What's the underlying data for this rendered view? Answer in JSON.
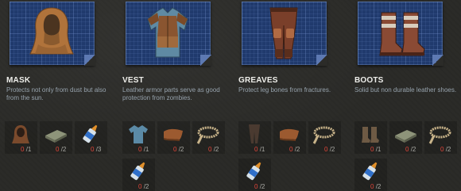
{
  "items": [
    {
      "title": "MASK",
      "description": "Protects not only from dust but also from the sun.",
      "item_icon": "hooded-mask-icon",
      "materials": [
        {
          "icon": "face-cloth-icon",
          "have": "0",
          "need": "/1"
        },
        {
          "icon": "fabric-stack-icon",
          "have": "0",
          "need": "/2"
        },
        {
          "icon": "glue-bottle-icon",
          "have": "0",
          "need": "/3"
        }
      ]
    },
    {
      "title": "VEST",
      "description": "Leather armor parts serve as good protection from zombies.",
      "item_icon": "armored-vest-icon",
      "materials": [
        {
          "icon": "shirt-icon",
          "have": "0",
          "need": "/1"
        },
        {
          "icon": "leather-icon",
          "have": "0",
          "need": "/2"
        },
        {
          "icon": "rope-icon",
          "have": "0",
          "need": "/2"
        },
        {
          "icon": "glue-bottle-icon",
          "have": "0",
          "need": "/2"
        }
      ]
    },
    {
      "title": "GREAVES",
      "description": "Protect leg bones from fractures.",
      "item_icon": "greaves-icon",
      "materials": [
        {
          "icon": "pants-icon",
          "have": "0",
          "need": "/1"
        },
        {
          "icon": "leather-icon",
          "have": "0",
          "need": "/2"
        },
        {
          "icon": "rope-icon",
          "have": "0",
          "need": "/2"
        },
        {
          "icon": "glue-bottle-icon",
          "have": "0",
          "need": "/2"
        }
      ]
    },
    {
      "title": "BOOTS",
      "description": "Solid but non durable leather shoes.",
      "item_icon": "boots-icon",
      "materials": [
        {
          "icon": "shoes-icon",
          "have": "0",
          "need": "/1"
        },
        {
          "icon": "fabric-stack-icon",
          "have": "0",
          "need": "/2"
        },
        {
          "icon": "rope-icon",
          "have": "0",
          "need": "/2"
        },
        {
          "icon": "glue-bottle-icon",
          "have": "0",
          "need": "/2"
        }
      ]
    }
  ]
}
